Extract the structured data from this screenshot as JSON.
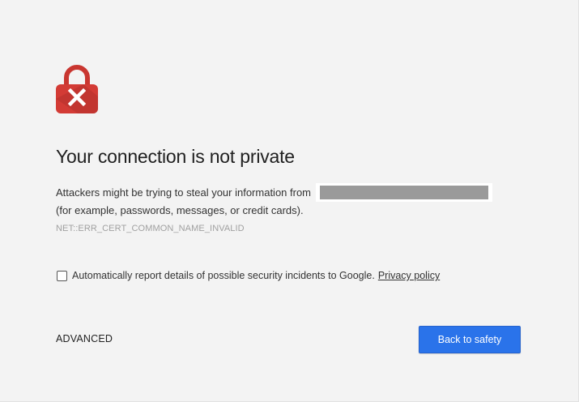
{
  "interstitial": {
    "icon": "lock-error-icon",
    "title": "Your connection is not private",
    "message_line1": "Attackers might be trying to steal your information from",
    "message_line2": "(for example, passwords, messages, or credit cards).",
    "error_code": "NET::ERR_CERT_COMMON_NAME_INVALID",
    "report_label": "Automatically report details of possible security incidents to Google.",
    "report_checked": false,
    "privacy_link": "Privacy policy",
    "advanced_label": "ADVANCED",
    "back_button_label": "Back to safety"
  },
  "colors": {
    "background": "#f3f3f3",
    "lock_red": "#d33b35",
    "button_blue": "#2a73ea",
    "redaction_gray": "#9a9a9a"
  }
}
